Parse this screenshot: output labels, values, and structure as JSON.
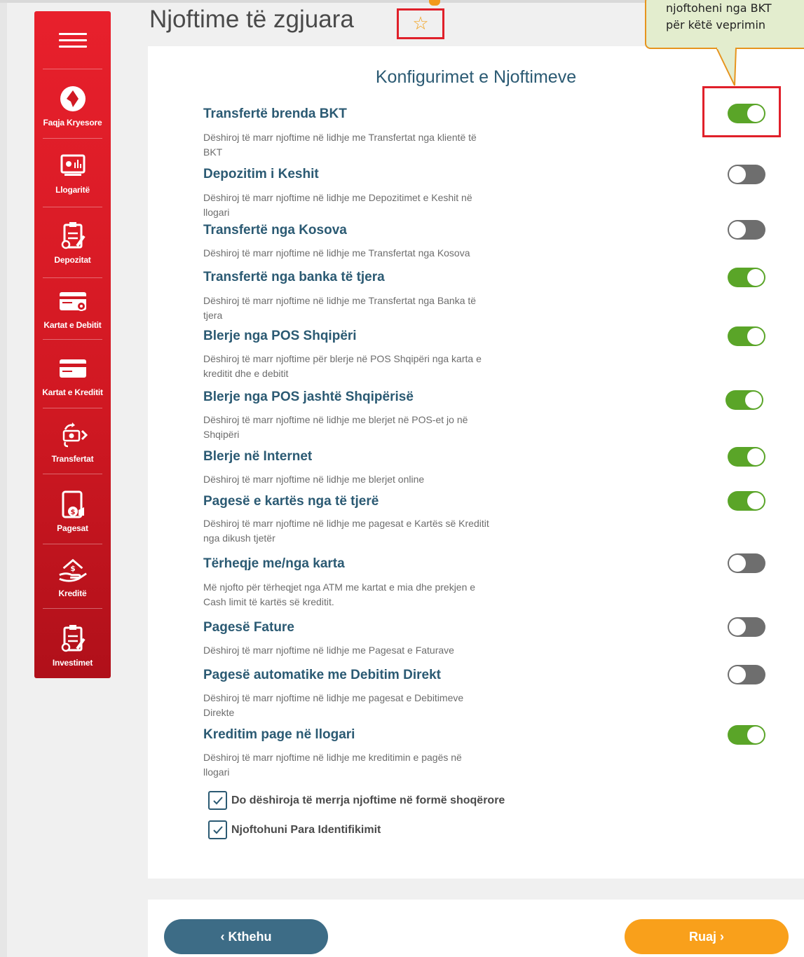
{
  "page": {
    "title": "Njoftime të zgjuara",
    "star_icon": "star-outline-icon"
  },
  "callout": {
    "line1": "njoftoheni nga BKT",
    "line2": "për këtë veprimin"
  },
  "sidebar": {
    "items": [
      {
        "label": "Faqja Kryesore",
        "icon": "home-logo-icon"
      },
      {
        "label": "Llogaritë",
        "icon": "accounts-icon"
      },
      {
        "label": "Depozitat",
        "icon": "deposits-icon"
      },
      {
        "label": "Kartat e Debitit",
        "icon": "debit-card-icon"
      },
      {
        "label": "Kartat e Kreditit",
        "icon": "credit-card-icon"
      },
      {
        "label": "Transfertat",
        "icon": "transfers-icon"
      },
      {
        "label": "Pagesat",
        "icon": "payments-icon"
      },
      {
        "label": "Kreditë",
        "icon": "loans-icon"
      },
      {
        "label": "Investimet",
        "icon": "investments-icon"
      }
    ]
  },
  "card": {
    "title": "Konfigurimet e Njoftimeve",
    "settings": [
      {
        "title": "Transfertë brenda BKT",
        "desc1": "Dëshiroj të marr njoftime në lidhje me Transfertat nga klientë të",
        "desc2": "BKT",
        "on": true
      },
      {
        "title": "Depozitim i Keshit",
        "desc1": "Dëshiroj të marr njoftime në lidhje me Depozitimet e Keshit në",
        "desc2": "llogari",
        "on": false
      },
      {
        "title": "Transfertë nga Kosova",
        "desc1": "Dëshiroj të marr njoftime në lidhje me Transfertat nga Kosova",
        "desc2": "",
        "on": false
      },
      {
        "title": "Transfertë nga banka të tjera",
        "desc1": "Dëshiroj të marr njoftime në lidhje me Transfertat nga Banka të",
        "desc2": "tjera",
        "on": true
      },
      {
        "title": "Blerje nga POS Shqipëri",
        "desc1": "Dëshiroj të marr njoftime për blerje në POS Shqipëri nga karta e",
        "desc2": "kreditit dhe e debitit",
        "on": true
      },
      {
        "title": "Blerje nga POS jashtë Shqipërisë",
        "desc1": "Dëshiroj të marr njoftime në lidhje me blerjet në POS-et jo në",
        "desc2": "Shqipëri",
        "on": true
      },
      {
        "title": "Blerje në Internet",
        "desc1": "Dëshiroj të marr njoftime në lidhje me blerjet online",
        "desc2": "",
        "on": true
      },
      {
        "title": "Pagesë e kartës nga të tjerë",
        "desc1": "Dëshiroj të marr njoftime në lidhje me pagesat e Kartës së Kreditit",
        "desc2": "nga dikush tjetër",
        "on": true
      },
      {
        "title": "Tërheqje me/nga karta",
        "desc1": "Më njofto për tërheqjet nga ATM me kartat e mia dhe prekjen e",
        "desc2": "Cash limit të kartës së kreditit.",
        "on": false
      },
      {
        "title": "Pagesë Fature",
        "desc1": "Dëshiroj të marr njoftime në lidhje me Pagesat e Faturave",
        "desc2": "",
        "on": false
      },
      {
        "title": "Pagesë automatike me Debitim Direkt",
        "desc1": "Dëshiroj të marr njoftime në lidhje me pagesat e Debitimeve",
        "desc2": "Direkte",
        "on": false
      },
      {
        "title": "Kreditim page në llogari",
        "desc1": "Dëshiroj të marr njoftime në lidhje me kreditimin e pagës në",
        "desc2": "llogari",
        "on": true
      }
    ],
    "checkboxes": [
      {
        "label": "Do dëshiroja të merrja njoftime në formë shoqërore",
        "checked": true
      },
      {
        "label": "Njoftohuni Para Identifikimit",
        "checked": true
      }
    ]
  },
  "footer": {
    "back_label": "‹  Kthehu",
    "save_label": "Ruaj  ›"
  },
  "colors": {
    "brand_red": "#e8202c",
    "toggle_on": "#5aa528",
    "toggle_off": "#6e6e6e",
    "heading_blue": "#2b5a73",
    "back_button": "#3d6c86",
    "save_button": "#f9a01b",
    "highlight_border": "#e0202a"
  }
}
